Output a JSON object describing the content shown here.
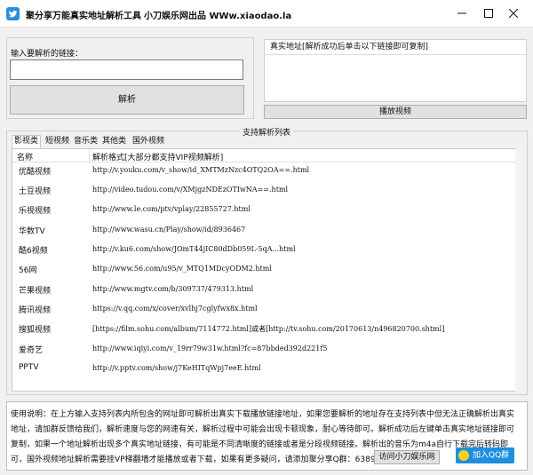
{
  "window": {
    "title": "聚分享万能真实地址解析工具",
    "subtitle": "小刀娱乐网出品 WWw.xiaodao.la"
  },
  "input": {
    "label": "输入要解析的链接：",
    "value": "",
    "placeholder": ""
  },
  "parse_button": "解析",
  "real_address": {
    "header": "真实地址[解析成功后单击以下链接即可复制]"
  },
  "play_button": "播放视频",
  "support_group": {
    "legend": "支持解析列表",
    "tabs": [
      {
        "label": "影视类",
        "active": true
      },
      {
        "label": "短视频",
        "active": false
      },
      {
        "label": "音乐类",
        "active": false
      },
      {
        "label": "其他类",
        "active": false
      },
      {
        "label": "国外视频",
        "active": false
      }
    ],
    "columns": {
      "name": "名称",
      "format": "解析格式[大部分都支持VIP视频解析]"
    },
    "rows": [
      {
        "name": "优酷视频",
        "format": "http://v.youku.com/v_show/id_XMTMzNzc4OTQ2OA==.html"
      },
      {
        "name": "土豆视频",
        "format": "http://video.tudou.com/v/XMjgzNDEzOTIwNA==.html"
      },
      {
        "name": "乐视视频",
        "format": "http://www.le.com/ptv/vplay/22855727.html"
      },
      {
        "name": "华数TV",
        "format": "http://www.wasu.cn/Play/show/id/8936467"
      },
      {
        "name": "酷6视频",
        "format": "http://v.ku6.com/show/JOmT44jIC80dDb059L-5qA...html"
      },
      {
        "name": "56网",
        "format": "http://www.56.com/u95/v_MTQ1MDcyODM2.html"
      },
      {
        "name": "芒果视频",
        "format": "http://www.mgtv.com/b/309737/479313.html"
      },
      {
        "name": "腾讯视频",
        "format": "https://v.qq.com/x/cover/xvlhj7cglyfwx8x.html"
      },
      {
        "name": "搜狐视频",
        "format": "[https://film.sohu.com/album/7114772.html]或者[http://tv.sohu.com/20170613/n496820700.shtml]"
      },
      {
        "name": "爱奇艺",
        "format": "http://www.iqiyi.com/v_19rr79w31w.html?fc=87bbded392d221f5"
      },
      {
        "name": "PPTV",
        "format": "http://v.pptv.com/show/j7KeHITqWpj7eeE.html"
      }
    ]
  },
  "info": {
    "text": "使用说明：在上方输入支持列表内所包含的网址即可解析出真实下载播放链接地址，如果您要解析的地址存在支持列表中但无法正确解析出真实地址，请加群反馈给我们，解析速度与您的网速有关，解析过程中可能会出现卡顿现象，耐心等待即可。解析成功后左键单击真实地址链接即可复制，如果一个地址解析出现多个真实地址链接，有可能是不同清晰度的链接或者是分段视频链接。解析出的音乐为m4a自行下载完后转码即可，国外视频地址解析需要挂VP梯翻墙才能播放或者下载，如果有更多疑问，请添加聚分享Q群：638919798咨询我们。"
  },
  "visit_button": "访问小刀娱乐网",
  "qq_button": "加入QQ群",
  "colors": {
    "accent": "#1e8fdf",
    "app_icon": "#2c8fde",
    "button_bg": "#e1e1e1"
  }
}
